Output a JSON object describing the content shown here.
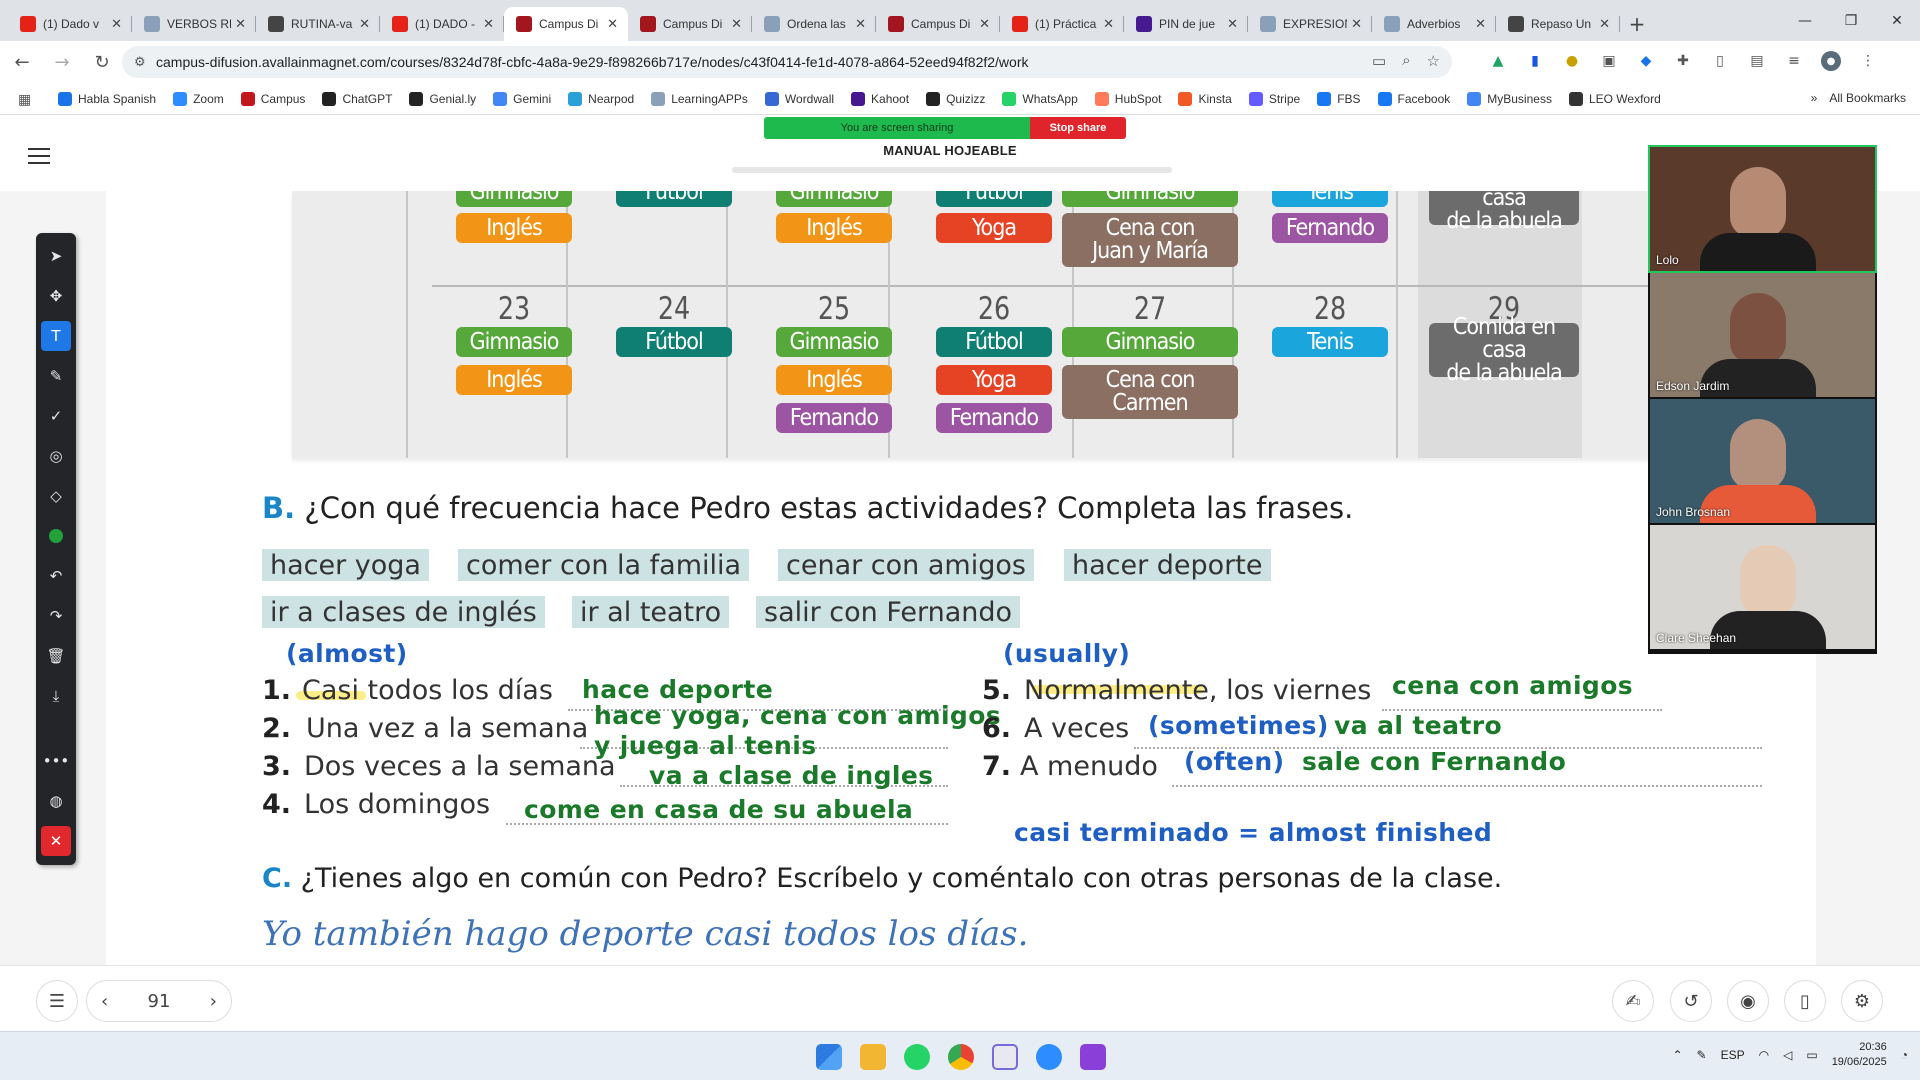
{
  "browser": {
    "tabs": [
      {
        "title": "(1) Dado v",
        "color": "#e62117"
      },
      {
        "title": "VERBOS RE",
        "color": "#8aa0b8"
      },
      {
        "title": "RUTINA-va",
        "color": "#444444"
      },
      {
        "title": "(1) DADO -",
        "color": "#e62117"
      },
      {
        "title": "Campus Di",
        "color": "#a3161d",
        "active": true
      },
      {
        "title": "Campus Di",
        "color": "#a3161d"
      },
      {
        "title": "Ordena las",
        "color": "#8aa0b8"
      },
      {
        "title": "Campus Di",
        "color": "#a3161d"
      },
      {
        "title": "(1) Práctica",
        "color": "#e62117"
      },
      {
        "title": "PIN de jue",
        "color": "#461a8f"
      },
      {
        "title": "EXPRESION",
        "color": "#8aa0b8"
      },
      {
        "title": "Adverbios",
        "color": "#8aa0b8"
      },
      {
        "title": "Repaso Un",
        "color": "#444444"
      }
    ],
    "url": "campus-difusion.avallainmagnet.com/courses/8324d78f-cbfc-4a8a-9e29-f898266b717e/nodes/c43f0414-fe1d-4078-a864-52eed94f82f2/work",
    "bookmarks": [
      {
        "label": "Habla Spanish",
        "color": "#1a73e8"
      },
      {
        "label": "Zoom",
        "color": "#2d8cff"
      },
      {
        "label": "Campus",
        "color": "#c2161e"
      },
      {
        "label": "ChatGPT",
        "color": "#222222"
      },
      {
        "label": "Genial.ly",
        "color": "#222222"
      },
      {
        "label": "Gemini",
        "color": "#4285f4"
      },
      {
        "label": "Nearpod",
        "color": "#2aa0d6"
      },
      {
        "label": "LearningAPPs",
        "color": "#8aa0b8"
      },
      {
        "label": "Wordwall",
        "color": "#3767d2"
      },
      {
        "label": "Kahoot",
        "color": "#46178f"
      },
      {
        "label": "Quizizz",
        "color": "#222222"
      },
      {
        "label": "WhatsApp",
        "color": "#25d366"
      },
      {
        "label": "HubSpot",
        "color": "#ff7a59"
      },
      {
        "label": "Kinsta",
        "color": "#f15a24"
      },
      {
        "label": "Stripe",
        "color": "#635bff"
      },
      {
        "label": "FBS",
        "color": "#1877f2"
      },
      {
        "label": "Facebook",
        "color": "#1877f2"
      },
      {
        "label": "MyBusiness",
        "color": "#4285f4"
      },
      {
        "label": "LEO Wexford",
        "color": "#333333"
      }
    ],
    "all_bookmarks": "All Bookmarks",
    "overflow": "»"
  },
  "sharing": {
    "status": "You are screen sharing",
    "stop": "Stop share"
  },
  "doc": {
    "title": "MANUAL HOJEABLE"
  },
  "calendar": {
    "top_row": [
      {
        "col": 0,
        "items": [
          {
            "t": "Gimnasio",
            "c": "gym"
          },
          {
            "t": "Inglés",
            "c": "ing"
          }
        ]
      },
      {
        "col": 1,
        "items": [
          {
            "t": "Fútbol",
            "c": "fut"
          }
        ]
      },
      {
        "col": 2,
        "items": [
          {
            "t": "Gimnasio",
            "c": "gym"
          },
          {
            "t": "Inglés",
            "c": "ing"
          }
        ]
      },
      {
        "col": 3,
        "items": [
          {
            "t": "Fútbol",
            "c": "fut"
          },
          {
            "t": "Yoga",
            "c": "yog"
          }
        ]
      },
      {
        "col": 4,
        "items": [
          {
            "t": "Gimnasio",
            "c": "gym"
          },
          {
            "t": "Cena con|Juan y María",
            "c": "cen"
          }
        ]
      },
      {
        "col": 5,
        "items": [
          {
            "t": "Tenis",
            "c": "ten"
          },
          {
            "t": "Fernando",
            "c": "fer"
          }
        ]
      },
      {
        "col": 6,
        "items": [
          {
            "t": "Comida en casa|de la abuela",
            "c": "abu"
          }
        ]
      }
    ],
    "days": [
      "23",
      "24",
      "25",
      "26",
      "27",
      "28",
      "29"
    ],
    "bottom_row": [
      {
        "col": 0,
        "items": [
          {
            "t": "Gimnasio",
            "c": "gym"
          },
          {
            "t": "Inglés",
            "c": "ing"
          }
        ]
      },
      {
        "col": 1,
        "items": [
          {
            "t": "Fútbol",
            "c": "fut"
          }
        ]
      },
      {
        "col": 2,
        "items": [
          {
            "t": "Gimnasio",
            "c": "gym"
          },
          {
            "t": "Inglés",
            "c": "ing"
          },
          {
            "t": "Fernando",
            "c": "fer"
          }
        ]
      },
      {
        "col": 3,
        "items": [
          {
            "t": "Fútbol",
            "c": "fut"
          },
          {
            "t": "Yoga",
            "c": "yog"
          },
          {
            "t": "Fernando",
            "c": "fer"
          }
        ]
      },
      {
        "col": 4,
        "items": [
          {
            "t": "Gimnasio",
            "c": "gym"
          },
          {
            "t": "Cena con|Carmen",
            "c": "cen"
          }
        ]
      },
      {
        "col": 5,
        "items": [
          {
            "t": "Tenis",
            "c": "ten"
          }
        ]
      },
      {
        "col": 6,
        "items": [
          {
            "t": "Comida en casa|de la abuela",
            "c": "abu"
          }
        ]
      }
    ]
  },
  "section_b": {
    "letter": "B.",
    "title": "¿Con qué frecuencia hace Pedro estas actividades? Completa las frases.",
    "chips": [
      "hacer yoga",
      "comer con la familia",
      "cenar con amigos",
      "hacer deporte",
      "ir a clases de inglés",
      "ir al teatro",
      "salir con Fernando"
    ],
    "items": [
      {
        "n": "1.",
        "text": "Casi todos los días",
        "answer": "hace deporte"
      },
      {
        "n": "2.",
        "text": "Una vez a la semana",
        "answer": "hace yoga, cena con amigos",
        "answer2": "y juega al tenis"
      },
      {
        "n": "3.",
        "text": "Dos veces a la semana",
        "answer": "va a clase de ingles"
      },
      {
        "n": "4.",
        "text": "Los domingos",
        "answer": "come en casa de su abuela"
      },
      {
        "n": "5.",
        "text": "Normalmente, los viernes",
        "answer": "cena con amigos"
      },
      {
        "n": "6.",
        "text": "A veces",
        "note": "(sometimes)",
        "answer": "va al teatro"
      },
      {
        "n": "7.",
        "text": "A menudo",
        "note": "(often)",
        "answer": "sale con Fernando"
      }
    ],
    "note_almost": "(almost)",
    "note_usually": "(usually)",
    "note_casi": "casi terminado = almost finished"
  },
  "section_c": {
    "letter": "C.",
    "title": "¿Tienes algo en común con Pedro? Escríbelo y coméntalo con otras personas de la clase.",
    "example": "Yo también hago deporte casi todos los días."
  },
  "participants": [
    {
      "name": "Lolo",
      "bg": "#5a3a2a"
    },
    {
      "name": "Edson Jardim",
      "bg": "#8a7a6a"
    },
    {
      "name": "John Brosnan",
      "bg": "#3a5a6a"
    },
    {
      "name": "Clare Sheehan",
      "bg": "#d8d6d2"
    }
  ],
  "pager": {
    "page": "91"
  },
  "taskbar": {
    "lang": "ESP",
    "time": "20:36",
    "date": "19/06/2025"
  }
}
